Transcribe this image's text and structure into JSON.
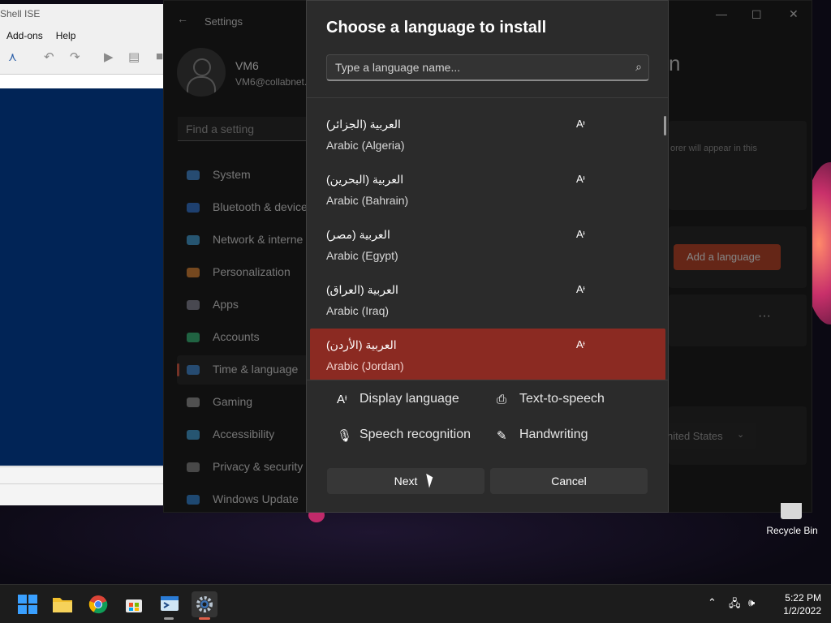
{
  "ise": {
    "title": "Shell ISE",
    "menu": [
      "Add-ons",
      "Help"
    ]
  },
  "settings": {
    "title": "Settings",
    "user_name": "VM6",
    "user_email": "VM6@collabnet.",
    "search_placeholder": "Find a setting",
    "nav": [
      {
        "label": "System",
        "icon": "system-icon",
        "color": "#4a90d9"
      },
      {
        "label": "Bluetooth & device",
        "icon": "bluetooth-icon",
        "color": "#3a7bd5"
      },
      {
        "label": "Network & interne",
        "icon": "network-icon",
        "color": "#4aa3d8"
      },
      {
        "label": "Personalization",
        "icon": "brush-icon",
        "color": "#e08a3c"
      },
      {
        "label": "Apps",
        "icon": "apps-icon",
        "color": "#8a8a9a"
      },
      {
        "label": "Accounts",
        "icon": "accounts-icon",
        "color": "#3fbf7f"
      },
      {
        "label": "Time & language",
        "icon": "globe-icon",
        "color": "#4a90d9"
      },
      {
        "label": "Gaming",
        "icon": "gaming-icon",
        "color": "#9a9a9a"
      },
      {
        "label": "Accessibility",
        "icon": "accessibility-icon",
        "color": "#4aa3d8"
      },
      {
        "label": "Privacy & security",
        "icon": "shield-icon",
        "color": "#8a8a8a"
      },
      {
        "label": "Windows Update",
        "icon": "update-icon",
        "color": "#3a8ad8"
      }
    ],
    "active_index": 6,
    "background": {
      "heading_fragment": "n",
      "hint_fragment": "orer will appear in this",
      "add_language_label": "Add a language",
      "region_fragment": "nited States"
    }
  },
  "dialog": {
    "title": "Choose a language to install",
    "search_placeholder": "Type a language name...",
    "languages": [
      {
        "native": "العربية (الجزائر)",
        "english": "Arabic (Algeria)"
      },
      {
        "native": "العربية (البحرين)",
        "english": "Arabic (Bahrain)"
      },
      {
        "native": "العربية (مصر)",
        "english": "Arabic (Egypt)"
      },
      {
        "native": "العربية (العراق)",
        "english": "Arabic (Iraq)"
      },
      {
        "native": "العربية (الأردن)",
        "english": "Arabic (Jordan)"
      }
    ],
    "selected_index": 4,
    "features": [
      {
        "label": "Display language",
        "icon": "display-language-icon"
      },
      {
        "label": "Text-to-speech",
        "icon": "text-to-speech-icon"
      },
      {
        "label": "Speech recognition",
        "icon": "microphone-icon"
      },
      {
        "label": "Handwriting",
        "icon": "handwriting-icon"
      }
    ],
    "next_label": "Next",
    "cancel_label": "Cancel"
  },
  "desktop": {
    "recycle_bin_label": "Recycle Bin"
  },
  "taskbar": {
    "apps": [
      "start-icon",
      "file-explorer-icon",
      "chrome-icon",
      "store-icon",
      "powershell-ise-icon",
      "settings-icon"
    ],
    "time": "5:22 PM",
    "date": "1/2/2022"
  }
}
